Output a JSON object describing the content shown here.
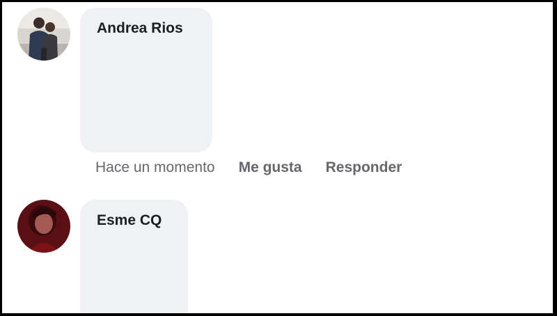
{
  "comments": [
    {
      "author": "Andrea Rios",
      "avatar_icon": "couple-photo-avatar",
      "timestamp": "Hace un momento",
      "like_label": "Me gusta",
      "reply_label": "Responder"
    },
    {
      "author": "Esme CQ",
      "avatar_icon": "profile-photo-avatar"
    }
  ],
  "colors": {
    "bubble_background": "#eff1f5",
    "author_text": "#1c1e21",
    "meta_text": "#65676b",
    "frame_border": "#000000"
  }
}
